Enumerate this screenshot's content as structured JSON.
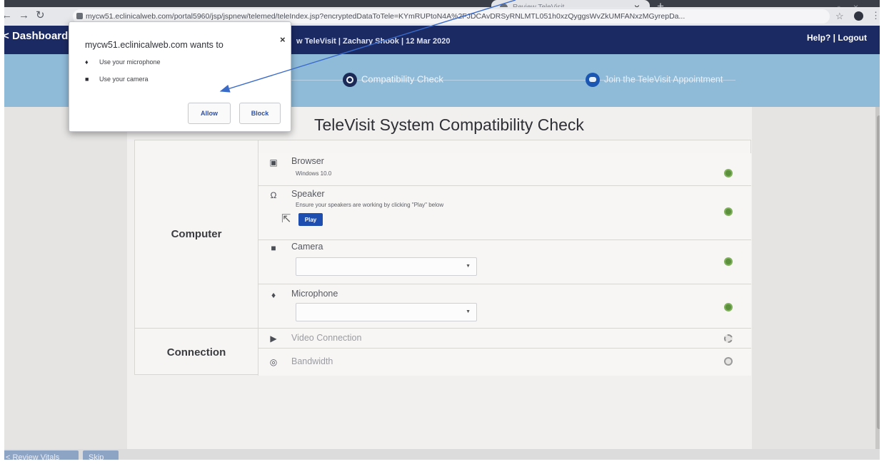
{
  "browser": {
    "tab_title": "Review TeleVisit",
    "url": "mycw51.eclinicalweb.com/portal5960/jsp/jspnew/telemed/teleIndex.jsp?encryptedDataToTele=KYmRUPtoN4A%2FJDCAvDRSyRNLMTL051h0xzQyggsWvZkUMFANxzMGyrepDa..."
  },
  "header": {
    "dashboard_label": "Dashboard",
    "visit_info": "w TeleVisit | Zachary Shook | 12 Mar 2020",
    "help_logout": "Help? | Logout"
  },
  "steps": [
    {
      "label": "Compatibility Check"
    },
    {
      "label": "Join the TeleVisit Appointment"
    }
  ],
  "page": {
    "title": "TeleVisit System Compatibility Check"
  },
  "sections": {
    "computer": "Computer",
    "connection": "Connection"
  },
  "checks": {
    "browser": {
      "label": "Browser",
      "detail": "Windows 10.0",
      "status": "ok"
    },
    "speaker": {
      "label": "Speaker",
      "detail": "Ensure your speakers are working by clicking \"Play\" below",
      "play_label": "Play",
      "status": "ok"
    },
    "camera": {
      "label": "Camera",
      "selected": "",
      "status": "ok"
    },
    "microphone": {
      "label": "Microphone",
      "selected": "",
      "status": "ok"
    },
    "video_connection": {
      "label": "Video Connection",
      "status": "loading"
    },
    "bandwidth": {
      "label": "Bandwidth",
      "status": "pending"
    }
  },
  "bottom_buttons": {
    "review": "< Review Vitals",
    "skip": "Skip"
  },
  "permission_popup": {
    "title": "mycw51.eclinicalweb.com wants to",
    "close": "×",
    "items": [
      "Use your microphone",
      "Use your camera"
    ],
    "allow_label": "Allow",
    "block_label": "Block"
  },
  "colors": {
    "header_navy": "#1c2a63",
    "stepbar_blue": "#8fbbd9",
    "play_blue": "#1e4eb0",
    "ok_green": "#5c8f3c",
    "annotation_arrow": "#3a6bc9"
  }
}
